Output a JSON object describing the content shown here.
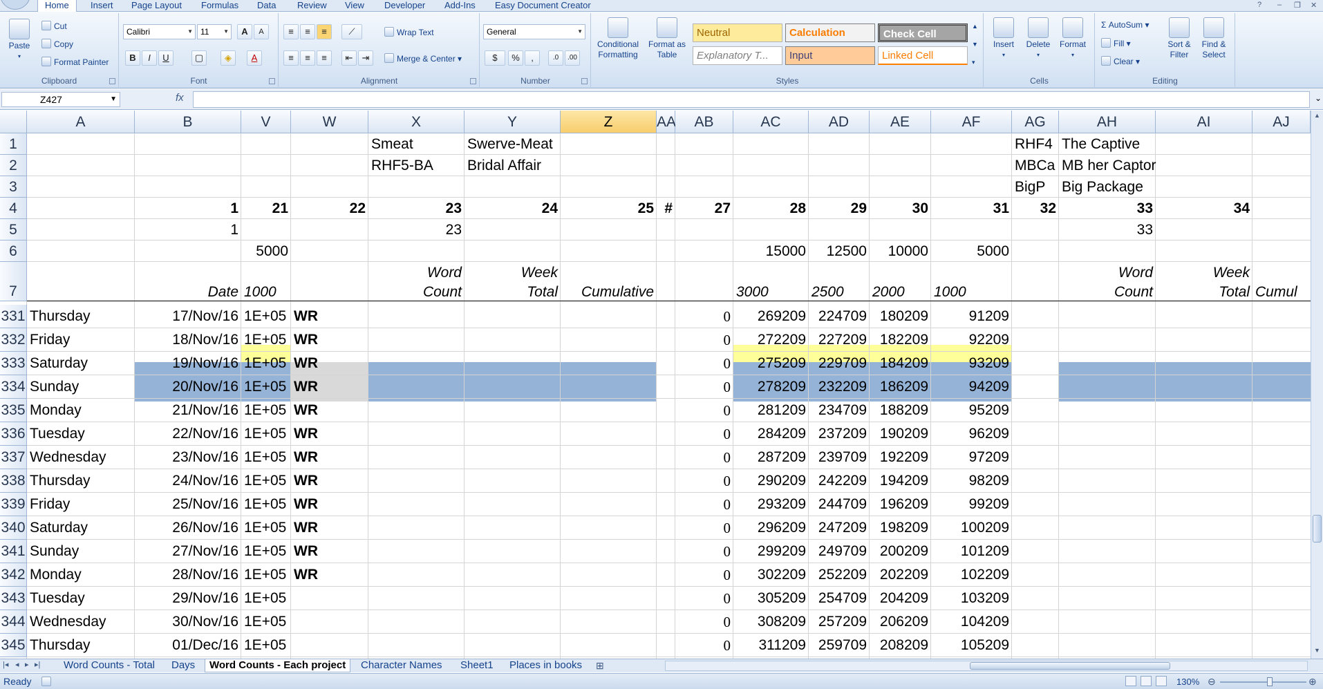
{
  "ribbon": {
    "tabs": [
      "Home",
      "Insert",
      "Page Layout",
      "Formulas",
      "Data",
      "Review",
      "View",
      "Developer",
      "Add-Ins",
      "Easy Document Creator"
    ],
    "active_tab": "Home",
    "clipboard": {
      "paste": "Paste",
      "cut": "Cut",
      "copy": "Copy",
      "format_painter": "Format Painter",
      "label": "Clipboard"
    },
    "font": {
      "name": "Calibri",
      "size": "11",
      "bold": "B",
      "italic": "I",
      "underline": "U",
      "label": "Font",
      "grow": "A",
      "shrink": "A",
      "color_letter": "A"
    },
    "alignment": {
      "wrap_text": "Wrap Text",
      "merge_center": "Merge & Center",
      "label": "Alignment"
    },
    "number": {
      "format": "General",
      "currency": "$",
      "percent": "%",
      "comma": ",",
      "label": "Number"
    },
    "styles": {
      "conditional": "Conditional Formatting",
      "format_table": "Format as Table",
      "label": "Styles",
      "neutral": "Neutral",
      "calculation": "Calculation",
      "check_cell": "Check Cell",
      "explanatory": "Explanatory T...",
      "input": "Input",
      "linked_cell": "Linked Cell"
    },
    "cells": {
      "insert": "Insert",
      "delete": "Delete",
      "format": "Format",
      "label": "Cells"
    },
    "editing": {
      "autosum": "AutoSum",
      "fill": "Fill",
      "clear": "Clear",
      "sort_filter": "Sort & Filter",
      "find_select": "Find & Select",
      "label": "Editing"
    }
  },
  "formula_bar": {
    "name_box": "Z427",
    "fx": "fx",
    "formula": ""
  },
  "columns": [
    "A",
    "B",
    "V",
    "W",
    "X",
    "Y",
    "Z",
    "AA",
    "AB",
    "AC",
    "AD",
    "AE",
    "AF",
    "AG",
    "AH",
    "AI",
    "AJ"
  ],
  "selected_column": "Z",
  "header_rows": {
    "r1": {
      "X": "Smeat",
      "Y": "Swerve-Meat",
      "AG": "RHF4",
      "AH": "The Captive"
    },
    "r2": {
      "X": "RHF5-BA",
      "Y": "Bridal Affair",
      "AG": "MBCa",
      "AH": "MB her Captor"
    },
    "r3": {
      "AG": "BigP",
      "AH": "Big Package"
    },
    "r4": {
      "B": "1",
      "V": "21",
      "W": "22",
      "X": "23",
      "Y": "24",
      "Z": "25",
      "AA": "#",
      "AB": "27",
      "AC": "28",
      "AD": "29",
      "AE": "30",
      "AF": "31",
      "AG": "32",
      "AH": "33",
      "AI": "34"
    },
    "r5": {
      "B": "1",
      "X": "23",
      "AH": "33"
    },
    "r6": {
      "V": "5000",
      "AC": "15000",
      "AD": "12500",
      "AE": "10000",
      "AF": "5000"
    },
    "r7_top": {
      "X": "Word",
      "Y": "Week",
      "AH": "Word",
      "AI": "Week"
    },
    "r7_bottom": {
      "B": "Date",
      "V": "1000",
      "X": "Count",
      "Y": "Total",
      "Z": "Cumulative",
      "AC": "3000",
      "AD": "2500",
      "AE": "2000",
      "AF": "1000",
      "AH": "Count",
      "AI": "Total",
      "AJ": "Cumul"
    }
  },
  "header_row_numbers": [
    "1",
    "2",
    "3",
    "4",
    "5",
    "6",
    "7"
  ],
  "rows": [
    {
      "n": "331",
      "day": "Thursday",
      "date": "17/Nov/16",
      "v": "1E+05",
      "w": "WR",
      "ab": "0",
      "ac": "269209",
      "ad": "224709",
      "ae": "180209",
      "af": "91209"
    },
    {
      "n": "332",
      "day": "Friday",
      "date": "18/Nov/16",
      "v": "1E+05",
      "w": "WR",
      "ab": "0",
      "ac": "272209",
      "ad": "227209",
      "ae": "182209",
      "af": "92209"
    },
    {
      "n": "333",
      "day": "Saturday",
      "date": "19/Nov/16",
      "v": "1E+05",
      "w": "WR",
      "ab": "0",
      "ac": "275209",
      "ad": "229709",
      "ae": "184209",
      "af": "93209"
    },
    {
      "n": "334",
      "day": "Sunday",
      "date": "20/Nov/16",
      "v": "1E+05",
      "w": "WR",
      "ab": "0",
      "ac": "278209",
      "ad": "232209",
      "ae": "186209",
      "af": "94209"
    },
    {
      "n": "335",
      "day": "Monday",
      "date": "21/Nov/16",
      "v": "1E+05",
      "w": "WR",
      "ab": "0",
      "ac": "281209",
      "ad": "234709",
      "ae": "188209",
      "af": "95209"
    },
    {
      "n": "336",
      "day": "Tuesday",
      "date": "22/Nov/16",
      "v": "1E+05",
      "w": "WR",
      "ab": "0",
      "ac": "284209",
      "ad": "237209",
      "ae": "190209",
      "af": "96209"
    },
    {
      "n": "337",
      "day": "Wednesday",
      "date": "23/Nov/16",
      "v": "1E+05",
      "w": "WR",
      "ab": "0",
      "ac": "287209",
      "ad": "239709",
      "ae": "192209",
      "af": "97209"
    },
    {
      "n": "338",
      "day": "Thursday",
      "date": "24/Nov/16",
      "v": "1E+05",
      "w": "WR",
      "ab": "0",
      "ac": "290209",
      "ad": "242209",
      "ae": "194209",
      "af": "98209"
    },
    {
      "n": "339",
      "day": "Friday",
      "date": "25/Nov/16",
      "v": "1E+05",
      "w": "WR",
      "ab": "0",
      "ac": "293209",
      "ad": "244709",
      "ae": "196209",
      "af": "99209"
    },
    {
      "n": "340",
      "day": "Saturday",
      "date": "26/Nov/16",
      "v": "1E+05",
      "w": "WR",
      "ab": "0",
      "ac": "296209",
      "ad": "247209",
      "ae": "198209",
      "af": "100209"
    },
    {
      "n": "341",
      "day": "Sunday",
      "date": "27/Nov/16",
      "v": "1E+05",
      "w": "WR",
      "ab": "0",
      "ac": "299209",
      "ad": "249709",
      "ae": "200209",
      "af": "101209"
    },
    {
      "n": "342",
      "day": "Monday",
      "date": "28/Nov/16",
      "v": "1E+05",
      "w": "WR",
      "ab": "0",
      "ac": "302209",
      "ad": "252209",
      "ae": "202209",
      "af": "102209"
    },
    {
      "n": "343",
      "day": "Tuesday",
      "date": "29/Nov/16",
      "v": "1E+05",
      "w": "",
      "ab": "0",
      "ac": "305209",
      "ad": "254709",
      "ae": "204209",
      "af": "103209"
    },
    {
      "n": "344",
      "day": "Wednesday",
      "date": "30/Nov/16",
      "v": "1E+05",
      "w": "",
      "ab": "0",
      "ac": "308209",
      "ad": "257209",
      "ae": "206209",
      "af": "104209"
    },
    {
      "n": "345",
      "day": "Thursday",
      "date": "01/Dec/16",
      "v": "1E+05",
      "w": "",
      "ab": "0",
      "ac": "311209",
      "ad": "259709",
      "ae": "208209",
      "af": "105209"
    }
  ],
  "sheet_tabs": [
    "Word Counts - Total",
    "Days",
    "Word Counts - Each project",
    "Character Names",
    "Sheet1",
    "Places in books"
  ],
  "active_sheet": "Word Counts - Each project",
  "status": {
    "ready": "Ready",
    "zoom": "130%"
  },
  "colors": {
    "header_fill": "#95b3d7",
    "yellow_fill": "#ffff99",
    "gray_fill": "#d9d9d9",
    "selected_col": "#f8cd6d",
    "neutral": "#ffeb9c",
    "calculation": "#f2f2f2",
    "check_cell": "#a5a5a5",
    "input": "#ffcc99"
  }
}
